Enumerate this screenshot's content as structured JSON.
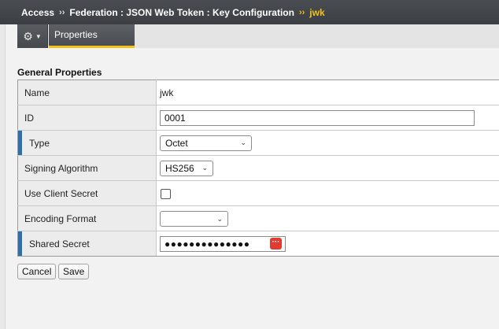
{
  "breadcrumb": {
    "items": [
      "Access",
      "Federation : JSON Web Token : Key Configuration"
    ],
    "separator": "››",
    "current": "jwk"
  },
  "tabs": [
    {
      "label": "Properties",
      "active": true
    }
  ],
  "section": {
    "title": "General Properties"
  },
  "form": {
    "name": {
      "label": "Name",
      "value": "jwk"
    },
    "id": {
      "label": "ID",
      "value": "0001"
    },
    "type": {
      "label": "Type",
      "value": "Octet",
      "required": true
    },
    "signing_algorithm": {
      "label": "Signing Algorithm",
      "value": "HS256"
    },
    "use_client_secret": {
      "label": "Use Client Secret",
      "checked": false
    },
    "encoding_format": {
      "label": "Encoding Format",
      "value": ""
    },
    "shared_secret": {
      "label": "Shared Secret",
      "masked_value": "●●●●●●●●●●●●●●",
      "required": true
    }
  },
  "buttons": {
    "cancel": "Cancel",
    "save": "Save"
  },
  "icons": {
    "gear": "gear-icon",
    "caret": "caret-down-icon",
    "reveal": "password-reveal-icon"
  },
  "colors": {
    "accent": "#f4c11b",
    "required_marker": "#2f6faa",
    "header_bg": "#3f4347"
  }
}
